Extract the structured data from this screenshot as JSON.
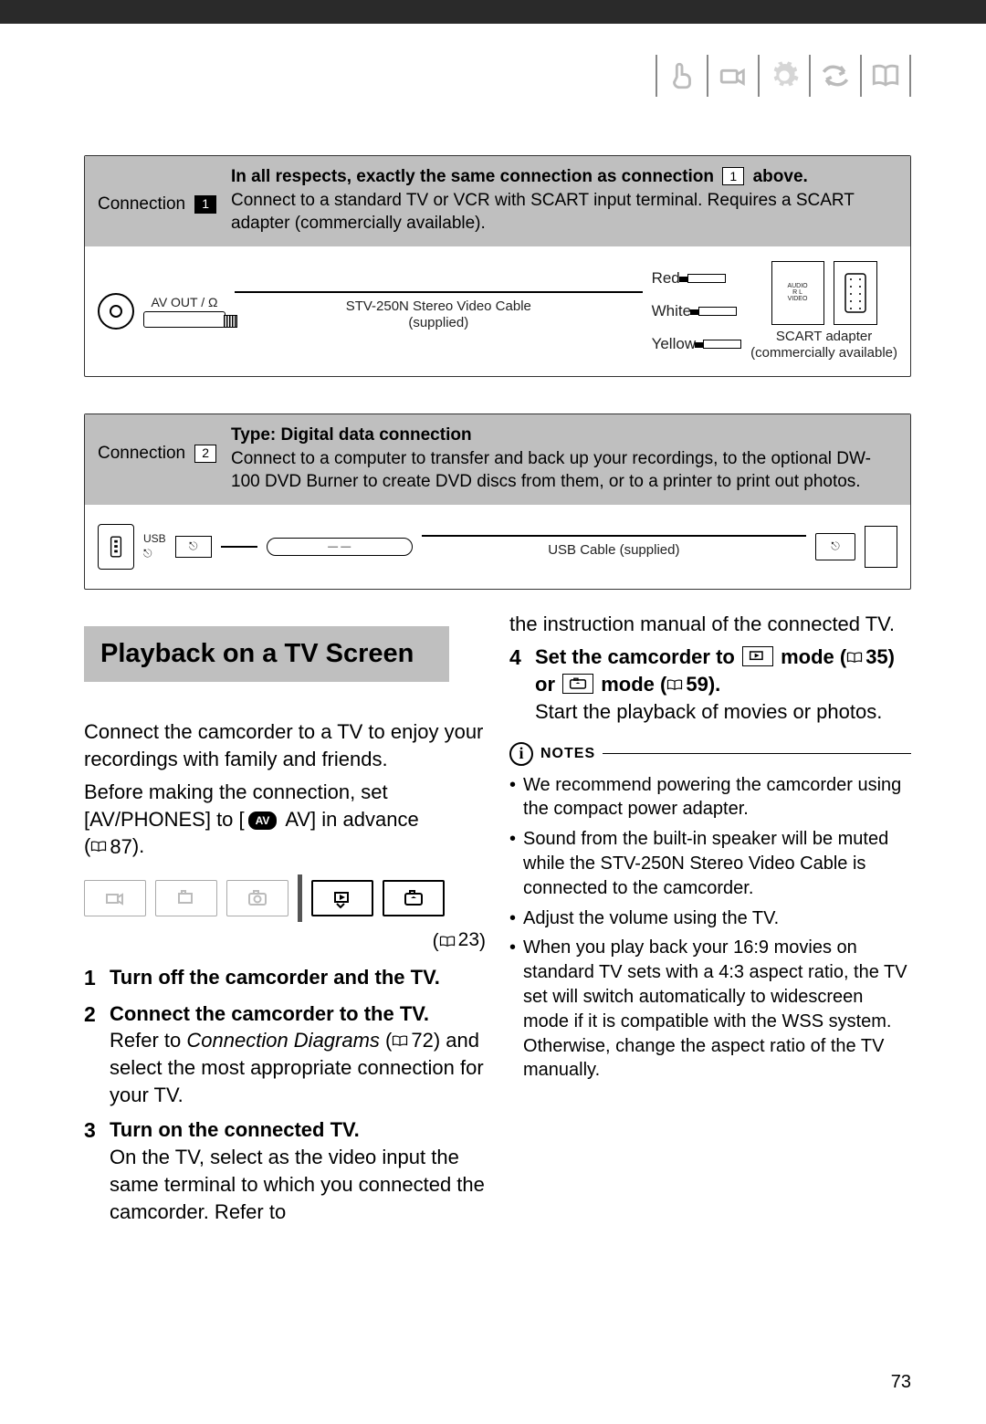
{
  "icon_strip": [
    "hand-point-icon",
    "camcorder-point-icon",
    "gear-icon",
    "arrows-icon",
    "book-icon"
  ],
  "connection1": {
    "label": "Connection",
    "badge": "1",
    "header_bold_pre": "In all respects, exactly the same connection as connection",
    "header_bold_post": "above.",
    "header_text": "Connect to a standard TV or VCR with SCART input terminal. Requires a SCART adapter (commercially available).",
    "av_out": "AV OUT /",
    "cable_name": "STV-250N Stereo Video Cable",
    "cable_supplied": "(supplied)",
    "rca": [
      "Red",
      "White",
      "Yellow"
    ],
    "scart_label": "SCART adapter",
    "scart_sub": "(commercially available)"
  },
  "connection2": {
    "label": "Connection",
    "badge": "2",
    "type_line": "Type: Digital data connection",
    "header_text": "Connect to a computer to transfer and back up your recordings, to the optional DW-100 DVD Burner to create DVD discs from them, or to a printer to print out photos.",
    "usb_label": "USB",
    "cable_name": "USB Cable (supplied)"
  },
  "section_title": "Playback on a TV Screen",
  "intro1": "Connect the camcorder to a TV to enjoy your recordings with family and friends.",
  "intro2_pre": "Before making the connection, set [AV/PHONES] to [",
  "intro2_av": "AV",
  "intro2_post": " AV] in advance",
  "intro2_ref": "87",
  "mode_ref": "23",
  "steps": {
    "s1": "Turn off the camcorder and the TV.",
    "s2": "Connect the camcorder to the TV.",
    "s2b_pre": "Refer to ",
    "s2b_italic": "Connection Diagrams",
    "s2b_ref": "72",
    "s2b_post": ") and select the most appropriate connection for your TV.",
    "s3": "Turn on the connected TV.",
    "s3b": "On the TV, select as the video input the same terminal to which you connected the camcorder. Refer to",
    "col2_top": "the instruction manual of the connected TV.",
    "s4_pre": "Set the camcorder to ",
    "s4_mid1": " mode (",
    "s4_ref1": "35",
    "s4_or": ") or ",
    "s4_mid2": " mode (",
    "s4_ref2": "59",
    "s4_end": ").",
    "s4b": "Start the playback of movies or photos."
  },
  "notes_label": "NOTES",
  "notes": [
    "We recommend powering the camcorder using the compact power adapter.",
    "Sound from the built-in speaker will be muted while the STV-250N Stereo Video Cable is connected to the camcorder.",
    "Adjust the volume using the TV.",
    "When you play back your 16:9 movies on standard TV sets with a 4:3 aspect ratio, the TV set will switch automatically to widescreen mode if it is compatible with the WSS system. Otherwise, change the aspect ratio of the TV manually."
  ],
  "page_number": "73"
}
